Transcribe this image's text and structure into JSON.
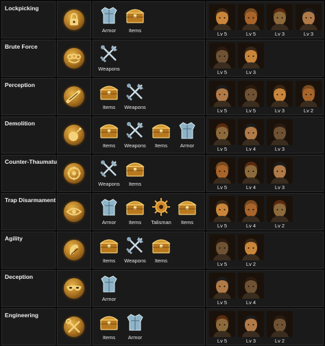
{
  "skills": [
    {
      "name": "Lockpicking",
      "icon": "lock-icon",
      "items": [
        {
          "label": "Armor",
          "icon": "armor-icon"
        },
        {
          "label": "Items",
          "icon": "chest-icon"
        }
      ],
      "characters": [
        {
          "level": "Lv 5"
        },
        {
          "level": "Lv 5"
        },
        {
          "level": "Lv 3"
        },
        {
          "level": "Lv 3"
        }
      ]
    },
    {
      "name": "Brute Force",
      "icon": "brass-knuckles-icon",
      "items": [
        {
          "label": "Weapons",
          "icon": "crossed-weapons-icon"
        }
      ],
      "characters": [
        {
          "level": "Lv 5"
        },
        {
          "level": "Lv 3"
        }
      ]
    },
    {
      "name": "Perception",
      "icon": "spyglass-icon",
      "items": [
        {
          "label": "Items",
          "icon": "chest-icon"
        },
        {
          "label": "Weapons",
          "icon": "crossed-weapons-icon"
        }
      ],
      "characters": [
        {
          "level": "Lv 5"
        },
        {
          "level": "Lv 5"
        },
        {
          "level": "Lv 3"
        },
        {
          "level": "Lv 2"
        }
      ]
    },
    {
      "name": "Demolition",
      "icon": "bomb-icon",
      "items": [
        {
          "label": "Items",
          "icon": "chest-icon"
        },
        {
          "label": "Weapons",
          "icon": "crossed-weapons-icon"
        },
        {
          "label": "Items",
          "icon": "chest-icon"
        },
        {
          "label": "Armor",
          "icon": "armor-icon"
        }
      ],
      "characters": [
        {
          "level": "Lv 5"
        },
        {
          "level": "Lv 4"
        },
        {
          "level": "Lv 3"
        }
      ]
    },
    {
      "name": "Counter-Thaumaturgy",
      "icon": "rune-circle-icon",
      "items": [
        {
          "label": "Weapons",
          "icon": "crossed-weapons-icon"
        },
        {
          "label": "Items",
          "icon": "chest-icon"
        }
      ],
      "characters": [
        {
          "level": "Lv 5"
        },
        {
          "level": "Lv 4"
        },
        {
          "level": "Lv 3"
        }
      ]
    },
    {
      "name": "Trap Disarmament",
      "icon": "eye-trap-icon",
      "items": [
        {
          "label": "Armor",
          "icon": "armor-icon"
        },
        {
          "label": "Items",
          "icon": "chest-icon"
        },
        {
          "label": "Talisman",
          "icon": "talisman-icon"
        },
        {
          "label": "Items",
          "icon": "chest-icon"
        }
      ],
      "characters": [
        {
          "level": "Lv 5"
        },
        {
          "level": "Lv 4"
        },
        {
          "level": "Lv 2"
        }
      ]
    },
    {
      "name": "Agility",
      "icon": "agility-icon",
      "items": [
        {
          "label": "Items",
          "icon": "chest-icon"
        },
        {
          "label": "Weapons",
          "icon": "crossed-weapons-icon"
        },
        {
          "label": "Items",
          "icon": "chest-icon"
        }
      ],
      "characters": [
        {
          "level": "Lv 5"
        },
        {
          "level": "Lv 2"
        }
      ]
    },
    {
      "name": "Deception",
      "icon": "mask-icon",
      "items": [
        {
          "label": "Armor",
          "icon": "armor-icon"
        }
      ],
      "characters": [
        {
          "level": "Lv 5"
        },
        {
          "level": "Lv 4"
        }
      ]
    },
    {
      "name": "Engineering",
      "icon": "tools-icon",
      "items": [
        {
          "label": "Items",
          "icon": "chest-icon"
        },
        {
          "label": "Armor",
          "icon": "armor-icon"
        }
      ],
      "characters": [
        {
          "level": "Lv 5"
        },
        {
          "level": "Lv 3"
        },
        {
          "level": "Lv 2"
        }
      ]
    }
  ],
  "colors": {
    "accent_gold": "#d9a441",
    "cell_bg": "#1a1a1a",
    "text": "#e8e8e8"
  }
}
